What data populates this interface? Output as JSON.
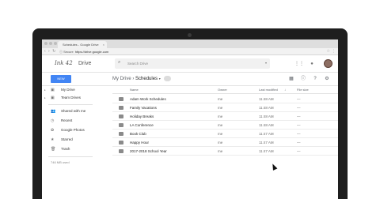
{
  "browser": {
    "tab_title": "Schedules - Google Drive",
    "tab_close": "×",
    "nav_glyphs": "‹ › ↻",
    "url_secure": "ⓘ Secure",
    "url_main": "https://drive.google.com",
    "star": "☆",
    "kebab": "⋮"
  },
  "header": {
    "logo": "Ink 42",
    "product": "Drive",
    "search_icon": "⌕",
    "search_placeholder": "Search Drive",
    "search_caret": "▾",
    "apps_icon": "⋮⋮",
    "notifications_icon": "●"
  },
  "toolbar": {
    "new_label": "NEW",
    "crumb_root": "My Drive",
    "crumb_sep": "›",
    "crumb_current": "Schedules",
    "crumb_caret": "▾",
    "grid_icon": "▦",
    "info_icon": "ⓘ",
    "help_icon": "?",
    "settings_icon": "⚙"
  },
  "sidebar": {
    "arrow": "▸",
    "items": [
      {
        "label": "My Drive",
        "icon": "▣"
      },
      {
        "label": "Team Drives",
        "icon": "▣"
      },
      {
        "label": "Shared with me",
        "icon": "👥"
      },
      {
        "label": "Recent",
        "icon": "◷"
      },
      {
        "label": "Google Photos",
        "icon": "✿"
      },
      {
        "label": "Starred",
        "icon": "★"
      },
      {
        "label": "Trash",
        "icon": "🗑"
      }
    ],
    "storage": "746 MB used"
  },
  "table": {
    "headers": {
      "name": "Name",
      "owner": "Owner",
      "modified": "Last modified",
      "sort": "↓",
      "size": "File size"
    },
    "rows": [
      {
        "name": "Adam Work Schedules",
        "owner": "me",
        "modified": "11:48 AM",
        "size": "—"
      },
      {
        "name": "Family Vacations",
        "owner": "me",
        "modified": "11:48 AM",
        "size": "—"
      },
      {
        "name": "Holiday Breaks",
        "owner": "me",
        "modified": "11:48 AM",
        "size": "—"
      },
      {
        "name": "LA Conference",
        "owner": "me",
        "modified": "11:48 AM",
        "size": "—"
      },
      {
        "name": "Book Club",
        "owner": "me",
        "modified": "11:47 AM",
        "size": "—"
      },
      {
        "name": "Happy Hour",
        "owner": "me",
        "modified": "11:47 AM",
        "size": "—"
      },
      {
        "name": "2017-2018 School Year",
        "owner": "me",
        "modified": "11:47 AM",
        "size": "—"
      }
    ]
  }
}
